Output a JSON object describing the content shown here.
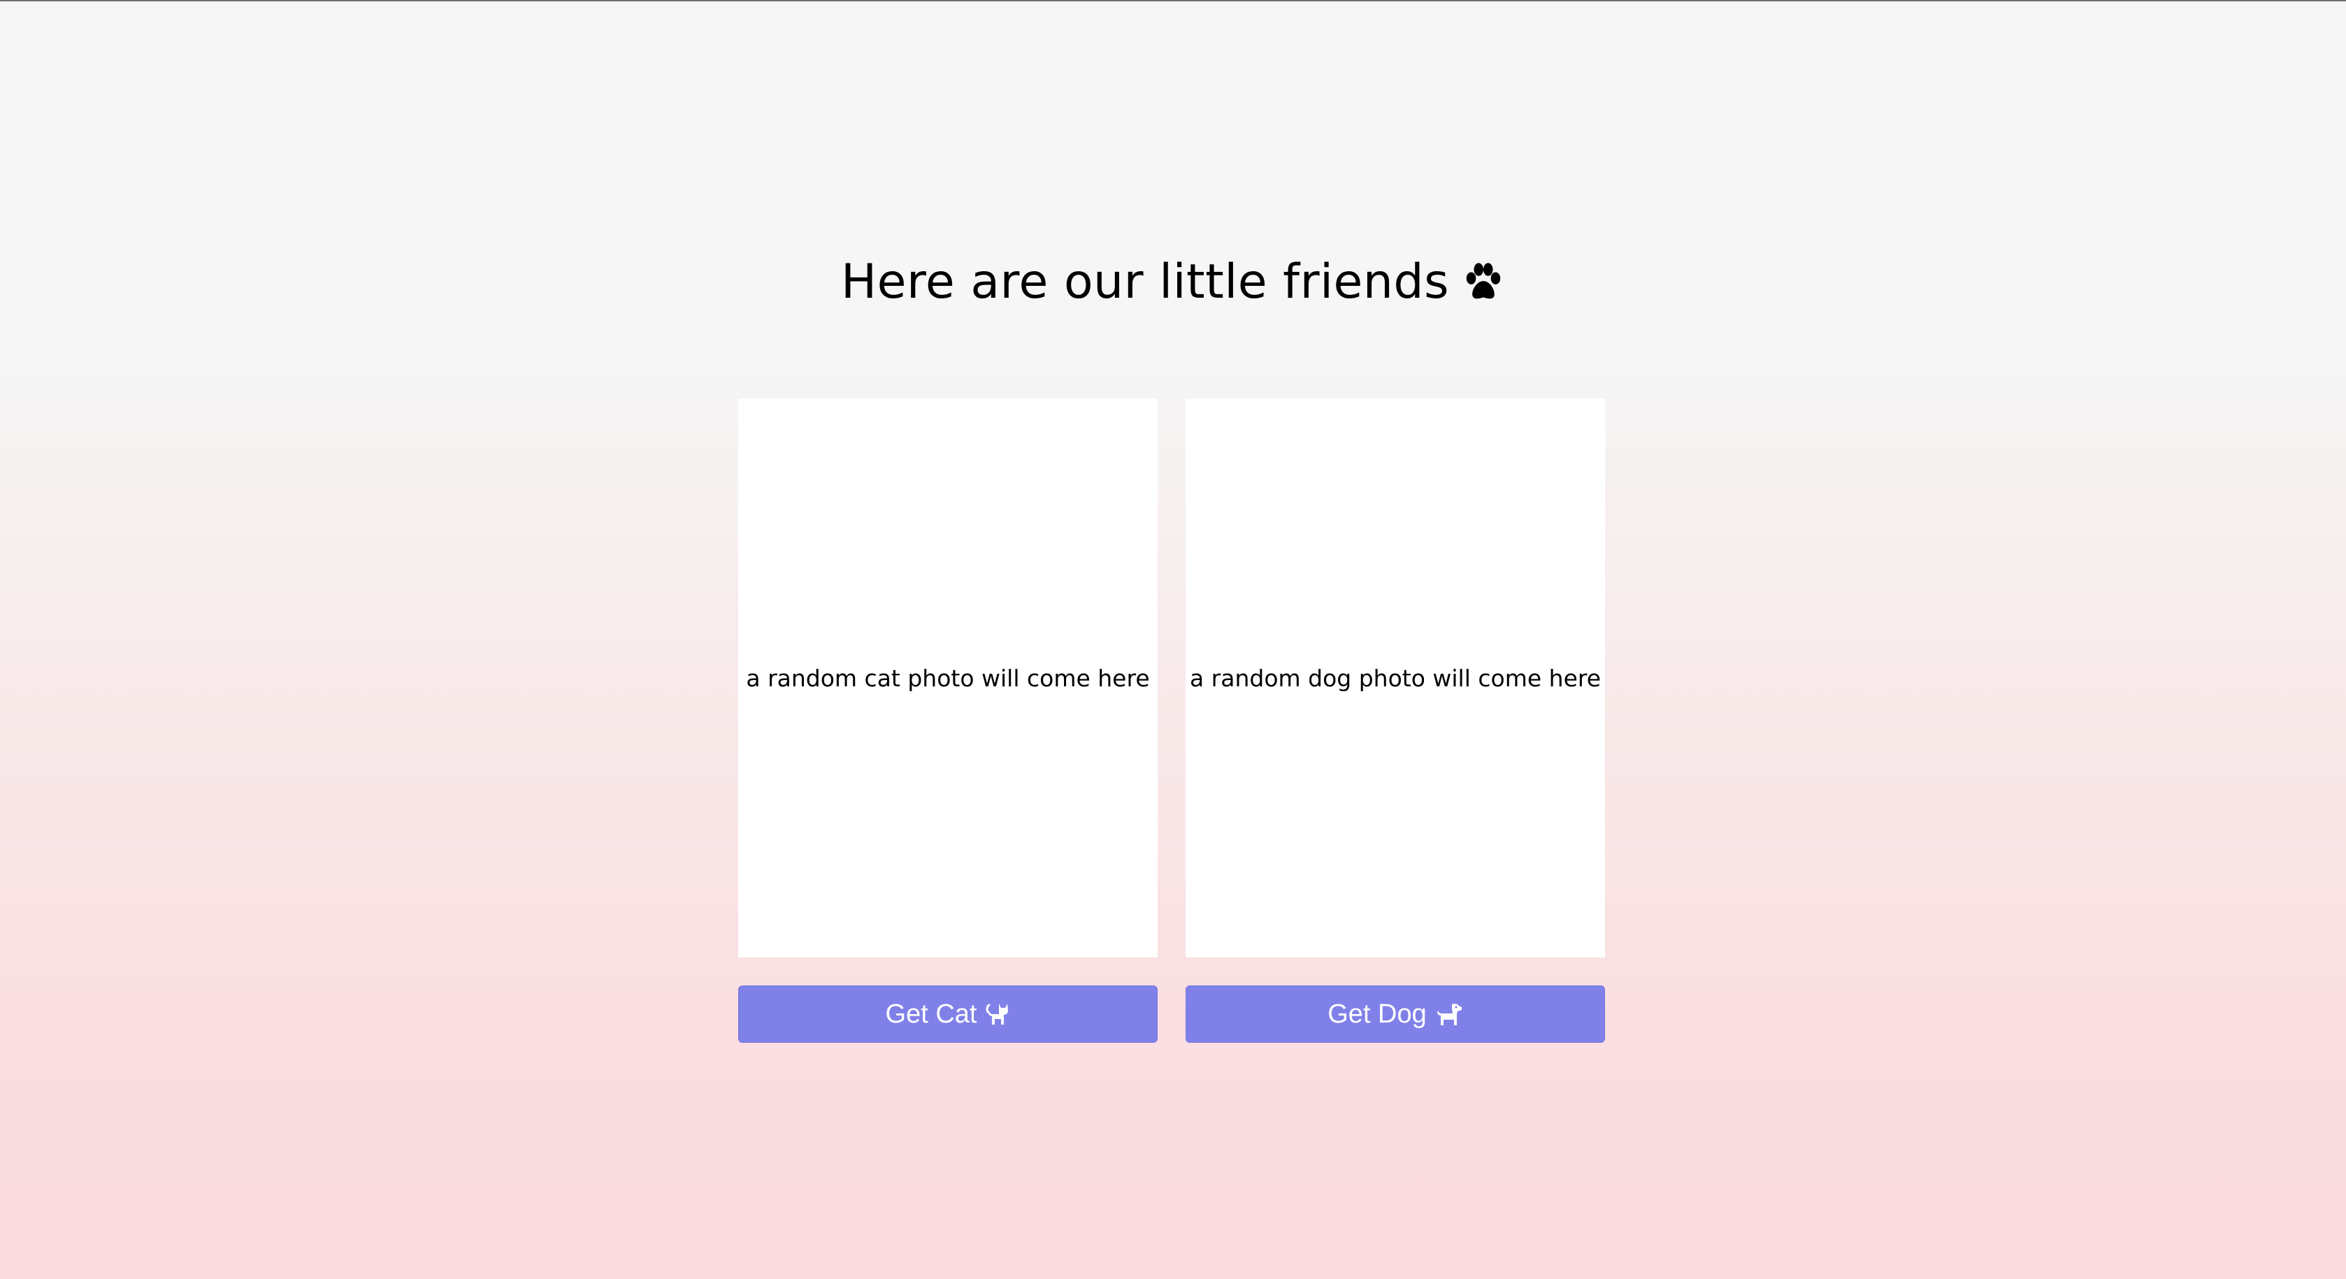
{
  "header": {
    "title": "Here are our little friends",
    "title_icon": "paw-icon"
  },
  "cat": {
    "placeholder": "a random cat photo will come here",
    "button_label": "Get Cat",
    "button_icon": "cat-icon"
  },
  "dog": {
    "placeholder": "a random dog photo will come here",
    "button_label": "Get Dog",
    "button_icon": "dog-icon"
  },
  "colors": {
    "button": "#8081e8",
    "background_top": "#f6f6f6",
    "background_bottom": "#fbdcdf"
  }
}
